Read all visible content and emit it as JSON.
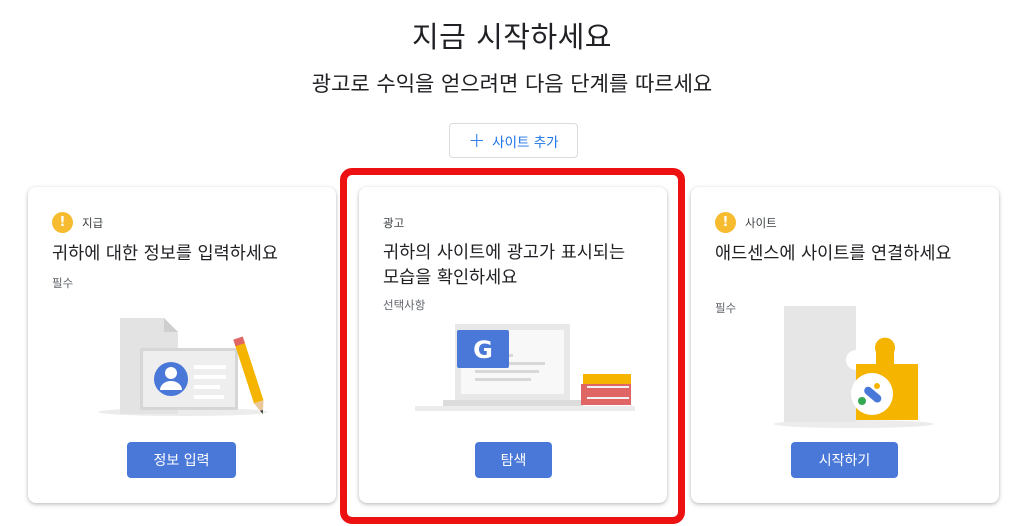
{
  "header": {
    "title": "지금 시작하세요",
    "subtitle": "광고로 수익을 얻으려면 다음 단계를 따르세요"
  },
  "add_site": {
    "label": "사이트 추가",
    "icon": "plus-icon"
  },
  "cards": [
    {
      "tag": "지급",
      "tag_icon": "warning-icon",
      "title": "귀하에 대한 정보를 입력하세요",
      "sub": "필수",
      "button": "정보 입력",
      "illustration": "id-card-illustration"
    },
    {
      "tag": "광고",
      "title": "귀하의 사이트에 광고가 표시되는 모습을 확인하세요",
      "sub": "선택사항",
      "button": "탐색",
      "illustration": "laptop-ads-illustration"
    },
    {
      "tag": "사이트",
      "tag_icon": "warning-icon",
      "title": "애드센스에 사이트를 연결하세요",
      "sub": "필수",
      "button": "시작하기",
      "illustration": "puzzle-adsense-illustration"
    }
  ],
  "colors": {
    "accent": "#1a73e8",
    "button": "#4a78d8",
    "warning": "#f6bb2e",
    "highlight": "#ee1111"
  }
}
